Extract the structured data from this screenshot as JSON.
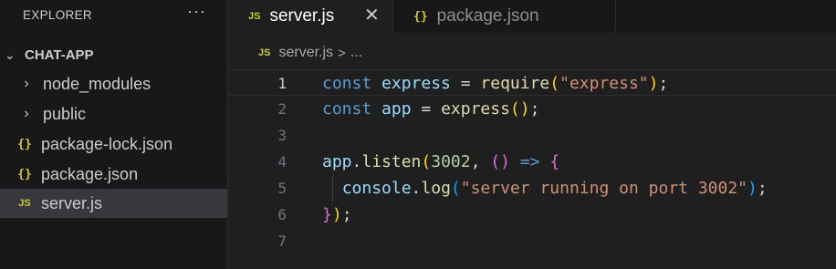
{
  "sidebar": {
    "header": "EXPLORER",
    "more": "···",
    "section_title": "CHAT-APP",
    "items": [
      {
        "label": "node_modules",
        "icon": "chevron-right-icon"
      },
      {
        "label": "public",
        "icon": "chevron-right-icon"
      },
      {
        "label": "package-lock.json",
        "icon": "json-icon"
      },
      {
        "label": "package.json",
        "icon": "json-icon"
      },
      {
        "label": "server.js",
        "icon": "js-icon",
        "selected": true
      }
    ]
  },
  "tabs": [
    {
      "label": "server.js",
      "icon_text": "JS",
      "active": true,
      "close": "✕"
    },
    {
      "label": "package.json",
      "icon_text": "{}",
      "active": false
    }
  ],
  "breadcrumb": {
    "icon_text": "JS",
    "file": "server.js",
    "separator": ">",
    "more": "..."
  },
  "icons": {
    "js": "JS",
    "json": "{}",
    "chevron_right": "›",
    "chevron_down": "⌄"
  },
  "colors": {
    "keyword": "#569cd6",
    "variable": "#9cdcfe",
    "function": "#dcdcaa",
    "string": "#ce9178",
    "number": "#b5cea8",
    "js_icon": "#cbcb41"
  },
  "editor": {
    "lines": [
      {
        "n": "1",
        "tokens": [
          [
            "const",
            "kw"
          ],
          [
            " ",
            "op"
          ],
          [
            "express",
            "var"
          ],
          [
            " = ",
            "op"
          ],
          [
            "require",
            "fn"
          ],
          [
            "(",
            "br1"
          ],
          [
            "\"express\"",
            "str"
          ],
          [
            ")",
            "br1"
          ],
          [
            ";",
            "op"
          ]
        ]
      },
      {
        "n": "2",
        "tokens": [
          [
            "const",
            "kw"
          ],
          [
            " ",
            "op"
          ],
          [
            "app",
            "var"
          ],
          [
            " = ",
            "op"
          ],
          [
            "express",
            "fn"
          ],
          [
            "()",
            "br1"
          ],
          [
            ";",
            "op"
          ]
        ]
      },
      {
        "n": "3",
        "tokens": []
      },
      {
        "n": "4",
        "tokens": [
          [
            "app",
            "var"
          ],
          [
            ".",
            "op"
          ],
          [
            "listen",
            "fn"
          ],
          [
            "(",
            "br1"
          ],
          [
            "3002",
            "num"
          ],
          [
            ", ",
            "op"
          ],
          [
            "()",
            "br2"
          ],
          [
            " ",
            "op"
          ],
          [
            "=>",
            "kw"
          ],
          [
            " ",
            "op"
          ],
          [
            "{",
            "br2"
          ]
        ]
      },
      {
        "n": "5",
        "tokens": [
          [
            "  ",
            "op"
          ],
          [
            "console",
            "var"
          ],
          [
            ".",
            "op"
          ],
          [
            "log",
            "fn"
          ],
          [
            "(",
            "br3"
          ],
          [
            "\"server running on port 3002\"",
            "str"
          ],
          [
            ")",
            "br3"
          ],
          [
            ";",
            "op"
          ]
        ]
      },
      {
        "n": "6",
        "tokens": [
          [
            "}",
            "br2"
          ],
          [
            ")",
            "br1"
          ],
          [
            ";",
            "op"
          ]
        ]
      },
      {
        "n": "7",
        "tokens": []
      }
    ]
  }
}
